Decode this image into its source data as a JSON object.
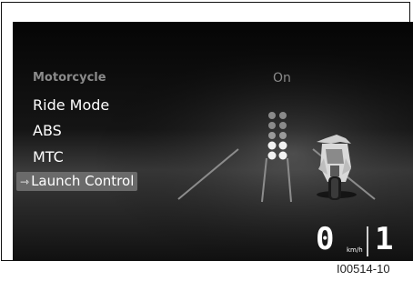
{
  "menu": {
    "header": "Motorcycle",
    "items": [
      "Ride Mode",
      "ABS",
      "MTC"
    ],
    "selected": {
      "label": "Launch Control",
      "icon": "arrow-right-icon"
    }
  },
  "status_value": "On",
  "speed": {
    "value": "0",
    "unit": "km/h"
  },
  "gear": "1",
  "figure_code": "I00514-10",
  "colors": {
    "background": "#0a0a0a",
    "highlight": "#6a6a6a",
    "text": "#ffffff",
    "dim_text": "#8a8a8a"
  }
}
